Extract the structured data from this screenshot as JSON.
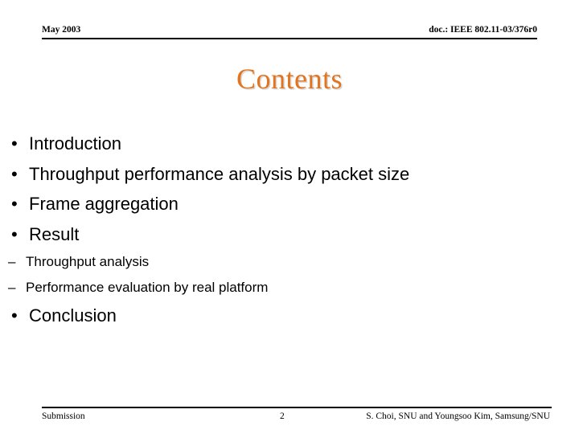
{
  "header": {
    "left": "May 2003",
    "right": "doc.: IEEE 802.11-03/376r0"
  },
  "title": "Contents",
  "title_color": "#E2741F",
  "content": {
    "group1": [
      {
        "marker": "•",
        "label": "Introduction"
      },
      {
        "marker": "•",
        "label": "Throughput performance analysis by packet size"
      },
      {
        "marker": "•",
        "label": "Frame aggregation"
      },
      {
        "marker": "•",
        "label": "Result"
      }
    ],
    "group2": [
      {
        "marker": "–",
        "label": "Throughput analysis"
      },
      {
        "marker": "–",
        "label": "Performance evaluation by real platform"
      }
    ],
    "group3": [
      {
        "marker": "•",
        "label": "Conclusion"
      }
    ]
  },
  "footer": {
    "left": "Submission",
    "page": "2",
    "right": "S. Choi, SNU and Youngsoo Kim, Samsung/SNU"
  }
}
